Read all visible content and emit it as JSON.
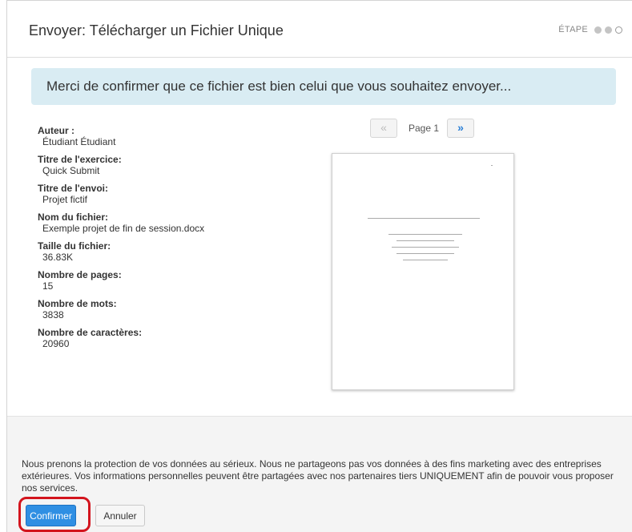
{
  "header": {
    "title": "Envoyer: Télécharger un Fichier Unique",
    "step_label": "ÉTAPE",
    "steps": [
      "done",
      "done",
      "pending"
    ]
  },
  "banner": {
    "text": "Merci de confirmer que ce fichier est bien celui que vous souhaitez envoyer..."
  },
  "metadata": [
    {
      "label": "Auteur :",
      "value": "Étudiant Étudiant"
    },
    {
      "label": "Titre de l'exercice:",
      "value": "Quick Submit"
    },
    {
      "label": "Titre de l'envoi:",
      "value": "Projet fictif"
    },
    {
      "label": "Nom du fichier:",
      "value": "Exemple projet de fin de session.docx"
    },
    {
      "label": "Taille du fichier:",
      "value": "36.83K"
    },
    {
      "label": "Nombre de pages:",
      "value": "15"
    },
    {
      "label": "Nombre de mots:",
      "value": "3838"
    },
    {
      "label": "Nombre de caractères:",
      "value": "20960"
    }
  ],
  "pager": {
    "prev_icon": "«",
    "label": "Page 1",
    "next_icon": "»"
  },
  "footer": {
    "privacy_text": "Nous prenons la protection de vos données au sérieux. Nous ne partageons pas vos données à des fins marketing avec des entreprises extérieures. Vos informations personnelles peuvent être partagées avec nos partenaires tiers UNIQUEMENT afin de pouvoir vous proposer nos services.",
    "confirm_label": "Confirmer",
    "cancel_label": "Annuler"
  },
  "colors": {
    "banner_bg": "#d9ecf3",
    "primary_button": "#2f8fe3",
    "highlight": "#d3141d",
    "footer_bg": "#f4f4f4"
  }
}
